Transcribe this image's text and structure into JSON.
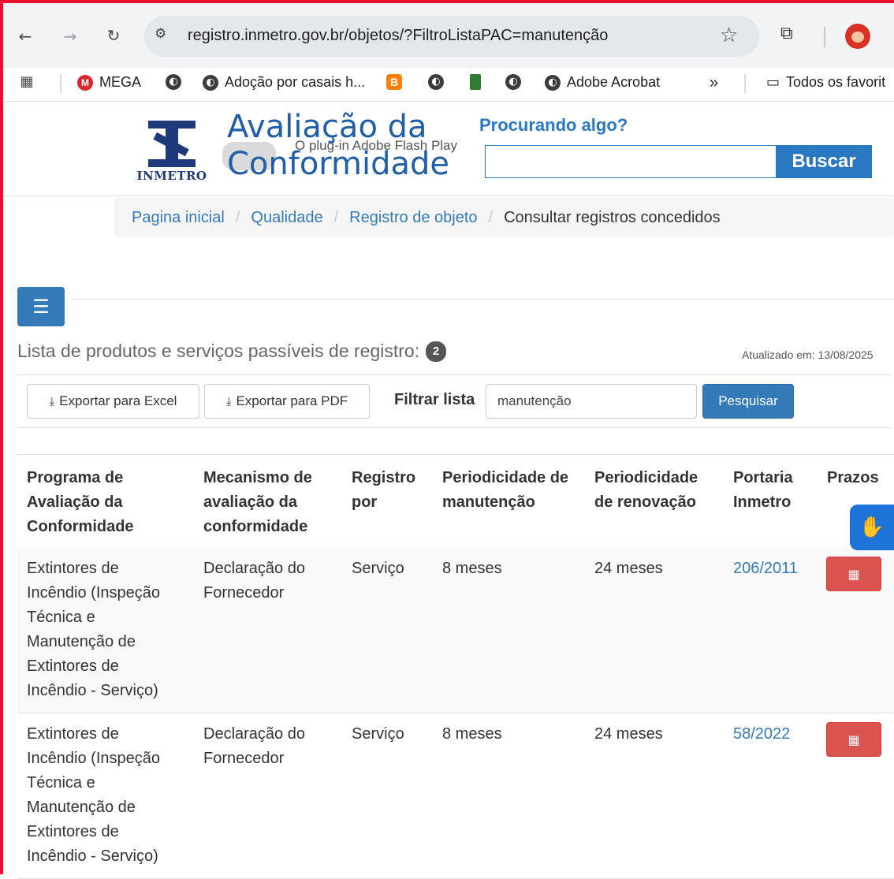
{
  "browser": {
    "url": "registro.inmetro.gov.br/objetos/?FiltroListaPAC=manutenção",
    "bookmarks": [
      {
        "label": "MEGA"
      },
      {
        "label": ""
      },
      {
        "label": "Adoção por casais h..."
      },
      {
        "label": ""
      },
      {
        "label": ""
      },
      {
        "label": ""
      },
      {
        "label": ""
      },
      {
        "label": "Adobe Acrobat"
      }
    ],
    "more_label": "»",
    "all_bookmarks_label": "Todos os favorit"
  },
  "header": {
    "logo_text": "INMETRO",
    "title_line1": "Avaliação da",
    "title_line2": "Conformidade",
    "flash_notice": "O plug-in Adobe Flash Play",
    "search_heading": "Procurando algo?",
    "search_button": "Buscar"
  },
  "breadcrumb": {
    "items": [
      "Pagina inicial",
      "Qualidade",
      "Registro de objeto"
    ],
    "active": "Consultar registros concedidos",
    "separator": "/"
  },
  "list": {
    "title": "Lista de produtos e serviços passíveis de registro:",
    "count": "2",
    "updated": "Atualizado em: 13/08/2025",
    "export_excel": "Exportar para Excel",
    "export_pdf": "Exportar para PDF",
    "filter_label": "Filtrar lista",
    "filter_value": "manutenção",
    "search_button": "Pesquisar"
  },
  "table": {
    "headers": {
      "programa": "Programa de Avaliação da Conformidade",
      "mecanismo": "Mecanismo de avaliação da conformidade",
      "registro": "Registro por",
      "manutencao": "Periodicidade de manutenção",
      "renovacao": "Periodicidade de renovação",
      "portaria": "Portaria Inmetro",
      "prazos": "Prazos"
    },
    "rows": [
      {
        "programa": "Extintores de Incêndio (Inspeção Técnica e Manutenção de Extintores de Incêndio - Serviço)",
        "mecanismo": "Declaração do Fornecedor",
        "registro": "Serviço",
        "manutencao": "8 meses",
        "renovacao": "24 meses",
        "portaria": "206/2011"
      },
      {
        "programa": "Extintores de Incêndio (Inspeção Técnica e Manutenção de Extintores de Incêndio - Serviço)",
        "mecanismo": "Declaração do Fornecedor",
        "registro": "Serviço",
        "manutencao": "8 meses",
        "renovacao": "24 meses",
        "portaria": "58/2022"
      }
    ]
  },
  "colors": {
    "primary": "#337ab7",
    "danger": "#d9534f",
    "title_blue": "#205fa8",
    "frame_red": "#e8112d"
  }
}
